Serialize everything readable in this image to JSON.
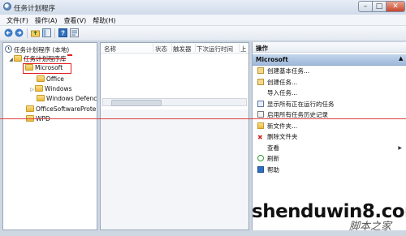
{
  "window": {
    "title": "任务计划程序",
    "btn_min": "–",
    "btn_max": "□",
    "btn_close": "✕"
  },
  "menu": [
    "文件(F)",
    "操作(A)",
    "查看(V)",
    "帮助(H)"
  ],
  "tree": {
    "root": "任务计划程序 (本地)",
    "library": "任务计划程序库",
    "microsoft": "Microsoft",
    "office": "Office",
    "windows": "Windows",
    "windows_defender": "Windows Defenc",
    "office_software": "OfficeSoftwareProte",
    "wpd": "WPD"
  },
  "columns": [
    "名称",
    "状态",
    "触发器",
    "下次运行时间",
    "上"
  ],
  "actions_panel": {
    "header": "操作",
    "section": "Microsoft",
    "items": [
      {
        "label": "创建基本任务...",
        "icon": "create-basic-task-icon"
      },
      {
        "label": "创建任务...",
        "icon": "create-task-icon"
      },
      {
        "label": "导入任务...",
        "icon": ""
      },
      {
        "label": "显示所有正在运行的任务",
        "icon": "running-tasks-icon"
      },
      {
        "label": "启用所有任务历史记录",
        "icon": "history-icon"
      },
      {
        "label": "新文件夹...",
        "icon": "new-folder-icon"
      },
      {
        "label": "删除文件夹",
        "icon": "delete-icon"
      },
      {
        "label": "查看",
        "icon": ""
      },
      {
        "label": "刷新",
        "icon": "refresh-icon"
      },
      {
        "label": "帮助",
        "icon": "help-icon"
      }
    ]
  },
  "watermark": {
    "text": "shenduwin8.com",
    "subtext": "脚本之家"
  },
  "colors": {
    "highlight_border": "#e02020",
    "section_blue": "#b6cbe6"
  }
}
